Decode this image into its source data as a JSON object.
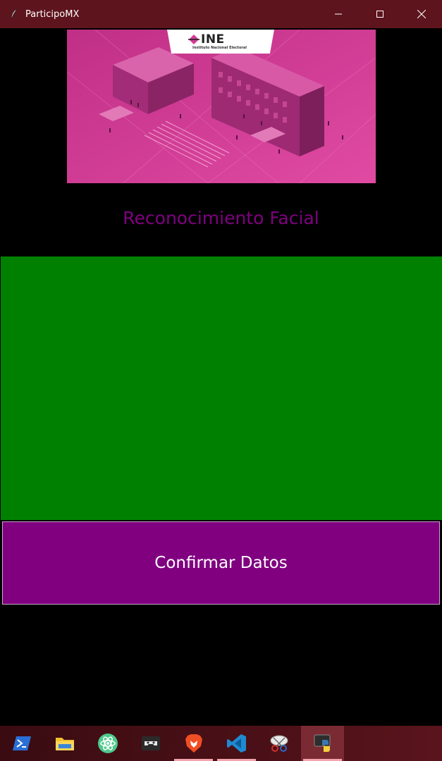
{
  "window": {
    "title": "ParticipoMX",
    "app_icon": "feather-icon",
    "controls": [
      "minimize-icon",
      "maximize-icon",
      "close-icon"
    ]
  },
  "banner": {
    "logo_text": "INE",
    "logo_subtext": "Instituto Nacional Electoral"
  },
  "heading": "Reconocimiento Facial",
  "confirm_button_label": "Confirmar Datos",
  "colors": {
    "titlebar": "#5e141d",
    "background": "#000000",
    "banner": "#d63a96",
    "heading": "#7f0080",
    "camera_area": "#008000",
    "button": "#800080",
    "button_text": "#ffffff"
  },
  "taskbar": {
    "items": [
      {
        "icon": "powershell-icon",
        "pinned_open": false
      },
      {
        "icon": "file-explorer-icon",
        "pinned_open": false
      },
      {
        "icon": "atom-icon",
        "pinned_open": false
      },
      {
        "icon": "game-controller-icon",
        "pinned_open": false
      },
      {
        "icon": "brave-browser-icon",
        "pinned_open": true
      },
      {
        "icon": "vscode-icon",
        "pinned_open": true
      },
      {
        "icon": "snipping-tool-icon",
        "pinned_open": false
      },
      {
        "icon": "python-icon",
        "pinned_open": true,
        "active": true
      }
    ]
  }
}
